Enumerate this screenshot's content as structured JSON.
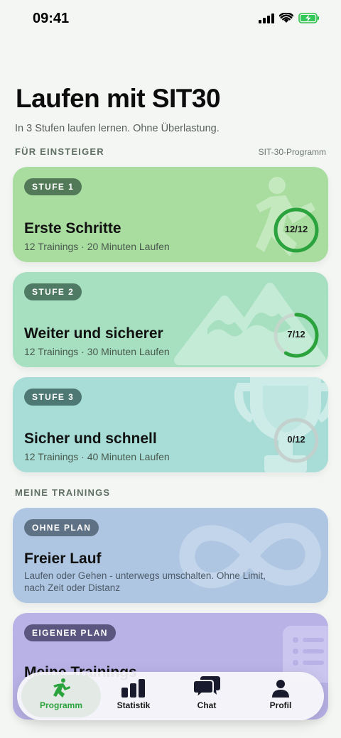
{
  "status_bar": {
    "time": "09:41"
  },
  "header": {
    "title": "Laufen mit SIT30",
    "subtitle": "In 3 Stufen laufen lernen. Ohne Überlastung."
  },
  "section_beginner": {
    "label": "FÜR EINSTEIGER",
    "right_label": "SIT-30-Programm"
  },
  "levels": [
    {
      "badge": "STUFE 1",
      "title": "Erste Schritte",
      "meta": "12 Trainings · 20 Minuten Laufen",
      "progress_label": "12/12",
      "progress": 1.0,
      "icon": "runner-icon"
    },
    {
      "badge": "STUFE 2",
      "title": "Weiter und sicherer",
      "meta": "12 Trainings · 30 Minuten Laufen",
      "progress_label": "7/12",
      "progress": 0.583,
      "icon": "mountains-icon"
    },
    {
      "badge": "STUFE 3",
      "title": "Sicher und schnell",
      "meta": "12 Trainings · 40 Minuten Laufen",
      "progress_label": "0/12",
      "progress": 0.0,
      "icon": "trophy-icon"
    }
  ],
  "section_trainings": {
    "label": "MEINE TRAININGS"
  },
  "trainings": [
    {
      "badge": "OHNE PLAN",
      "title": "Freier Lauf",
      "description": "Laufen oder Gehen - unterwegs umschalten. Ohne Limit, nach Zeit oder Distanz",
      "icon": "infinity-icon"
    },
    {
      "badge": "EIGENER PLAN",
      "title": "Meine Trainings",
      "icon": "list-icon"
    }
  ],
  "tabbar": {
    "tabs": [
      {
        "label": "Programm",
        "icon": "running-icon",
        "active": true
      },
      {
        "label": "Statistik",
        "icon": "bar-chart-icon",
        "active": false
      },
      {
        "label": "Chat",
        "icon": "chat-bubbles-icon",
        "active": false
      },
      {
        "label": "Profil",
        "icon": "person-icon",
        "active": false
      }
    ]
  },
  "colors": {
    "accent": "#2aa33d",
    "level1_bg": "#a9dda0",
    "level2_bg": "#a6e0c0",
    "level3_bg": "#a7ddd6",
    "free_run_bg": "#aec6e2",
    "own_plan_bg": "#b8b2e6"
  }
}
